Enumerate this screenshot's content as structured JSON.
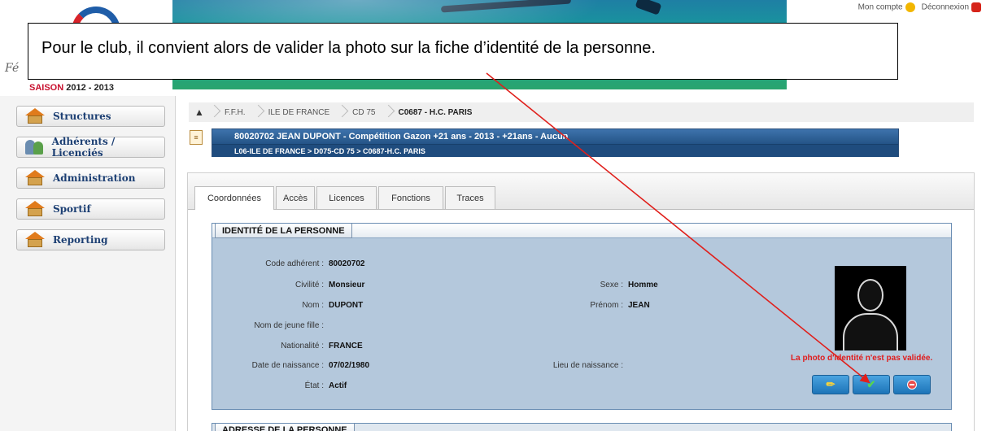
{
  "header": {
    "account_link": "Mon compte",
    "logout_link": "Déconnexion",
    "brand_script": "Fé",
    "season_label": "SAISON",
    "season_years": "2012 - 2013"
  },
  "callout": {
    "text": "Pour le club, il convient alors de valider la photo sur la fiche d’identité de la personne."
  },
  "sidebar": {
    "items": [
      {
        "label": "Structures",
        "icon": "house-icon"
      },
      {
        "label": "Adhérents / Licenciés",
        "icon": "people-icon"
      },
      {
        "label": "Administration",
        "icon": "house-icon"
      },
      {
        "label": "Sportif",
        "icon": "house-icon"
      },
      {
        "label": "Reporting",
        "icon": "house-icon"
      }
    ]
  },
  "breadcrumb": {
    "items": [
      "F.F.H.",
      "ILE DE FRANCE",
      "CD 75",
      "C0687 - H.C. PARIS"
    ]
  },
  "person_header": {
    "line1": "80020702 JEAN DUPONT - Compétition Gazon +21 ans - 2013 - +21ans - Aucun",
    "line2": "L06-ILE DE FRANCE > D075-CD 75 > C0687-H.C. PARIS"
  },
  "tabs": [
    "Coordonnées",
    "Accès",
    "Licences",
    "Fonctions",
    "Traces"
  ],
  "identity": {
    "title": "IDENTITÉ DE LA PERSONNE",
    "fields": {
      "code_label": "Code adhérent :",
      "code_value": "80020702",
      "civilite_label": "Civilité :",
      "civilite_value": "Monsieur",
      "nom_label": "Nom :",
      "nom_value": "DUPONT",
      "jeune_fille_label": "Nom de jeune fille :",
      "nationalite_label": "Nationalité :",
      "nationalite_value": "FRANCE",
      "naissance_label": "Date de naissance :",
      "naissance_value": "07/02/1980",
      "etat_label": "État :",
      "etat_value": "Actif",
      "sexe_label": "Sexe :",
      "sexe_value": "Homme",
      "prenom_label": "Prénom :",
      "prenom_value": "JEAN",
      "lieu_label": "Lieu de naissance :"
    },
    "photo_warning": "La photo d'identité n'est pas validée.",
    "buttons": {
      "edit_icon": "pencil-icon",
      "validate_icon": "check-icon",
      "reject_icon": "minus-circle-icon"
    }
  },
  "address": {
    "title": "ADRESSE DE LA PERSONNE"
  },
  "colors": {
    "header_blue": "#2f5f93",
    "identity_bg": "#b4c8dc",
    "warning_red": "#e01c1c",
    "arrow_red": "#e0201c"
  }
}
